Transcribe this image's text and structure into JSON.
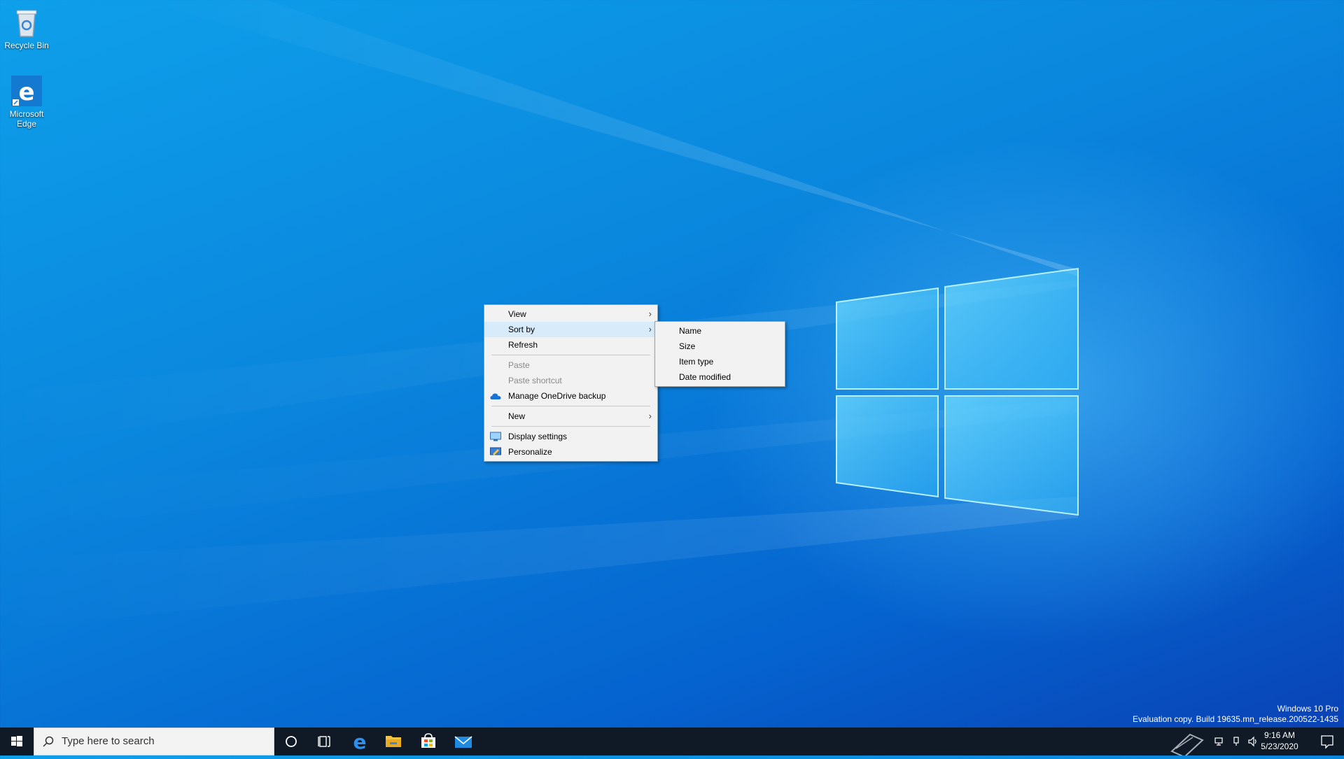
{
  "desktop": {
    "icons": [
      {
        "label": "Recycle Bin"
      },
      {
        "label": "Microsoft Edge"
      }
    ]
  },
  "context_menu": {
    "items": [
      {
        "label": "View"
      },
      {
        "label": "Sort by"
      },
      {
        "label": "Refresh"
      },
      {
        "label": "Paste"
      },
      {
        "label": "Paste shortcut"
      },
      {
        "label": "Manage OneDrive backup"
      },
      {
        "label": "New"
      },
      {
        "label": "Display settings"
      },
      {
        "label": "Personalize"
      }
    ]
  },
  "submenu": {
    "items": [
      {
        "label": "Name"
      },
      {
        "label": "Size"
      },
      {
        "label": "Item type"
      },
      {
        "label": "Date modified"
      }
    ]
  },
  "watermark": {
    "edition": "Windows 10 Pro",
    "build": "Evaluation copy. Build 19635.mn_release.200522-1435"
  },
  "taskbar": {
    "search_placeholder": "Type here to search",
    "time": "9:16 AM",
    "date": "5/23/2020"
  },
  "colors": {
    "taskbar": "#101a26",
    "menu_bg": "#f2f2f2",
    "menu_hover": "#d7ebfb",
    "accent": "#0a86dd"
  }
}
